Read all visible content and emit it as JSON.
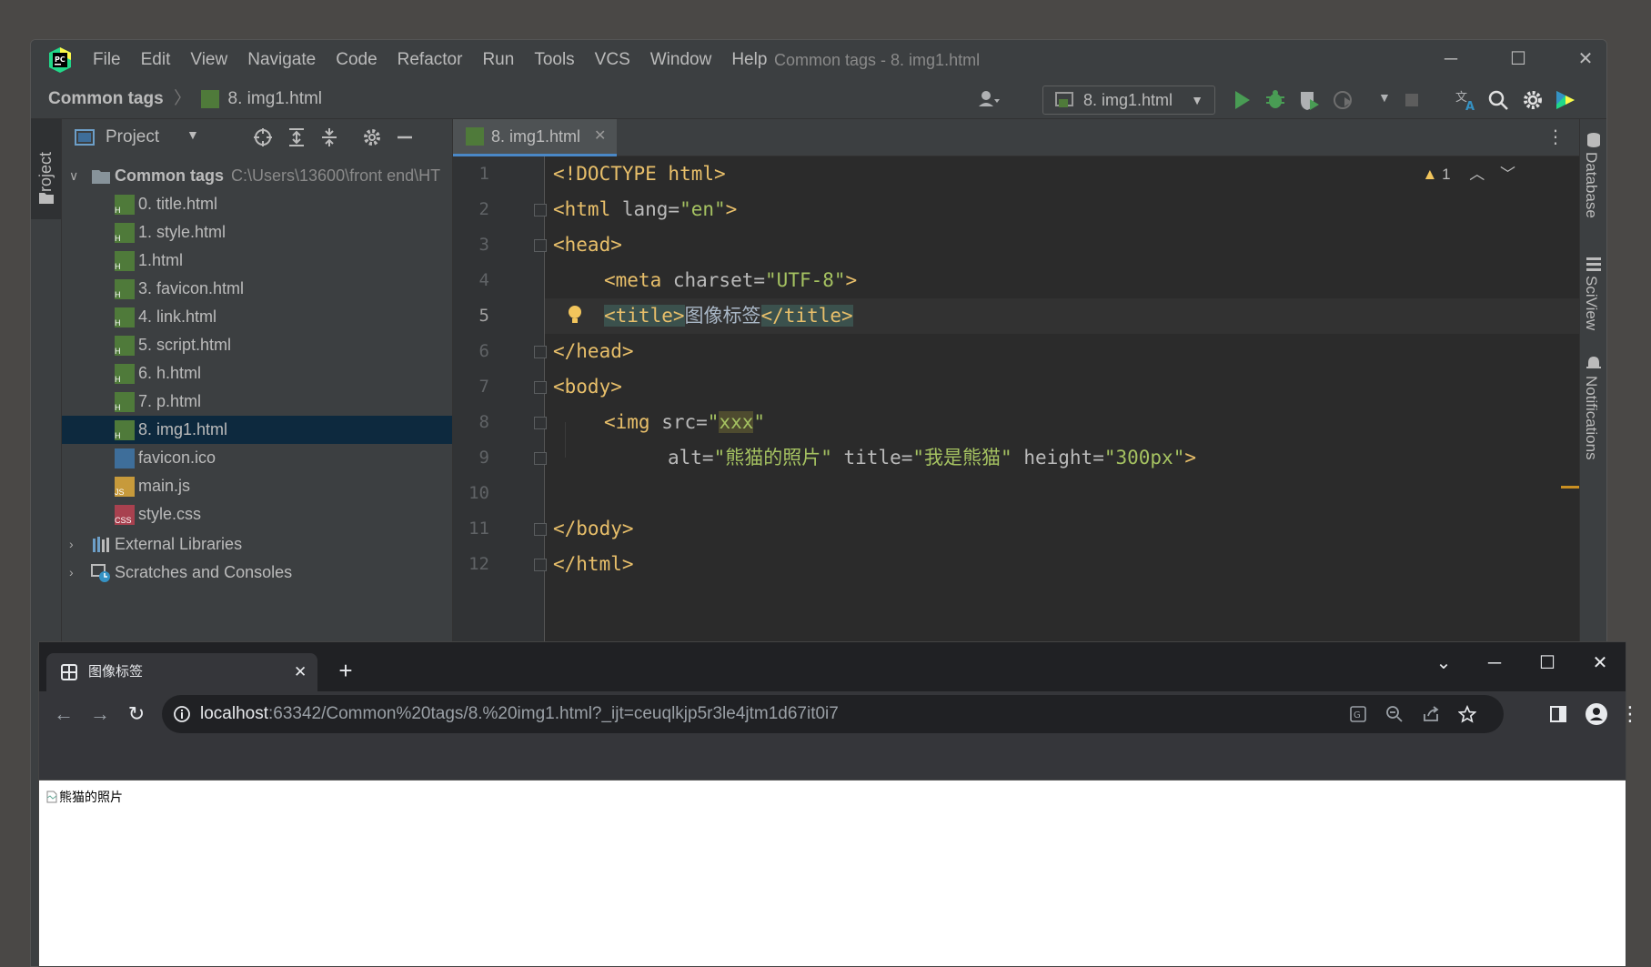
{
  "ide": {
    "menu": [
      "File",
      "Edit",
      "View",
      "Navigate",
      "Code",
      "Refactor",
      "Run",
      "Tools",
      "VCS",
      "Window",
      "Help"
    ],
    "title": "Common tags - 8. img1.html",
    "breadcrumb": {
      "project": "Common tags",
      "file": "8. img1.html"
    },
    "run_config": "8. img1.html"
  },
  "left_strip": {
    "project_tab": "Project"
  },
  "project_panel": {
    "title": "Project",
    "root": {
      "name": "Common tags",
      "path": "C:\\Users\\13600\\front end\\HT"
    },
    "files": [
      {
        "name": "0. title.html",
        "type": "html"
      },
      {
        "name": "1. style.html",
        "type": "html"
      },
      {
        "name": "1.html",
        "type": "html"
      },
      {
        "name": "3. favicon.html",
        "type": "html"
      },
      {
        "name": "4. link.html",
        "type": "html"
      },
      {
        "name": "5. script.html",
        "type": "html"
      },
      {
        "name": "6. h.html",
        "type": "html"
      },
      {
        "name": "7. p.html",
        "type": "html"
      },
      {
        "name": "8. img1.html",
        "type": "html",
        "selected": true
      },
      {
        "name": "favicon.ico",
        "type": "ico"
      },
      {
        "name": "main.js",
        "type": "js"
      },
      {
        "name": "style.css",
        "type": "css"
      }
    ],
    "external_libraries": "External Libraries",
    "scratches": "Scratches and Consoles"
  },
  "editor": {
    "tab": "8. img1.html",
    "warning_count": "1",
    "line_numbers": [
      "1",
      "2",
      "3",
      "4",
      "5",
      "6",
      "7",
      "8",
      "9",
      "10",
      "11",
      "12"
    ],
    "current_line": 5,
    "code": {
      "l1": "<!DOCTYPE html>",
      "l2_tag": "<html ",
      "l2_attr": "lang=",
      "l2_val": "\"en\"",
      "l2_end": ">",
      "l3": "<head>",
      "l4_tag": "<meta ",
      "l4_attr": "charset=",
      "l4_val": "\"UTF-8\"",
      "l4_end": ">",
      "l5_open": "<title>",
      "l5_text": "图像标签",
      "l5_close": "</title>",
      "l6": "</head>",
      "l7": "<body>",
      "l8_tag": "<img ",
      "l8_attr": "src=",
      "l8_q1": "\"",
      "l8_val": "xxx",
      "l8_q2": "\"",
      "l9_a1": "alt=",
      "l9_v1": "\"熊猫的照片\"",
      "l9_a2": " title=",
      "l9_v2": "\"我是熊猫\"",
      "l9_a3": " height=",
      "l9_v3": "\"300px\"",
      "l9_end": ">",
      "l11": "</body>",
      "l12": "</html>"
    }
  },
  "right_strip": {
    "database": "Database",
    "sciview": "SciView",
    "notifications": "Notifications"
  },
  "browser": {
    "tab_title": "图像标签",
    "url_host": "localhost",
    "url_rest": ":63342/Common%20tags/8.%20img1.html?_ijt=ceuqlkjp5r3le4jtm1d67it0i7",
    "broken_img_alt": "熊猫的照片"
  }
}
